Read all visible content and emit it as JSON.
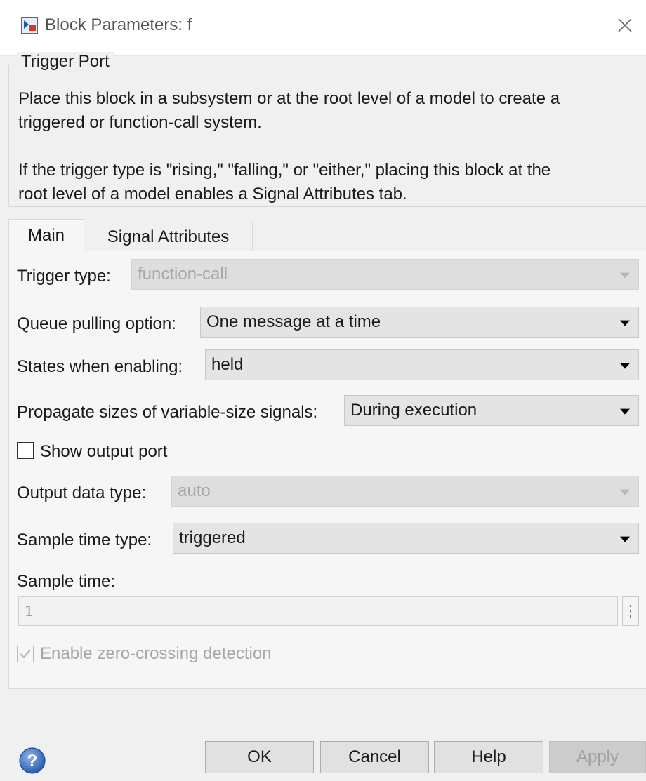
{
  "window": {
    "title": "Block Parameters: f",
    "app_icon": "simulink-block-icon",
    "close_icon": "close-icon"
  },
  "group": {
    "title": "Trigger Port",
    "description_1_line1": "Place this block in a subsystem or at the root level of a model to create a",
    "description_1_line2": "triggered or function-call system.",
    "description_2_line1": "If the trigger type is \"rising,\" \"falling,\" or \"either,\" placing this block at the",
    "description_2_line2": "root level of a model enables a Signal Attributes tab."
  },
  "tabs": [
    {
      "label": "Main",
      "selected": true
    },
    {
      "label": "Signal Attributes",
      "selected": false
    }
  ],
  "main": {
    "trigger_type": {
      "label": "Trigger type:",
      "value": "function-call",
      "enabled": false
    },
    "queue_pulling": {
      "label": "Queue pulling option:",
      "value": "One message at a time",
      "enabled": true
    },
    "states_enabling": {
      "label": "States when enabling:",
      "value": "held",
      "enabled": true
    },
    "propagate_sizes": {
      "label": "Propagate sizes of variable-size signals:",
      "value": "During execution",
      "enabled": true
    },
    "show_output_port": {
      "label": "Show output port",
      "checked": false,
      "enabled": true
    },
    "output_data_type": {
      "label": "Output data type:",
      "value": "auto",
      "enabled": false
    },
    "sample_time_type": {
      "label": "Sample time type:",
      "value": "triggered",
      "enabled": true
    },
    "sample_time": {
      "label": "Sample time:",
      "value": "1",
      "enabled": false,
      "more_icon": "vertical-ellipsis-icon"
    },
    "zero_crossing": {
      "label": "Enable zero-crossing detection",
      "checked": true,
      "enabled": false
    }
  },
  "buttons": {
    "help_icon": "help-icon",
    "ok": "OK",
    "cancel": "Cancel",
    "help": "Help",
    "apply": "Apply"
  },
  "colors": {
    "window_bg": "#f0f0f0",
    "disabled_text": "#a8a8a8",
    "help_icon_blue": "#2a5db0"
  }
}
